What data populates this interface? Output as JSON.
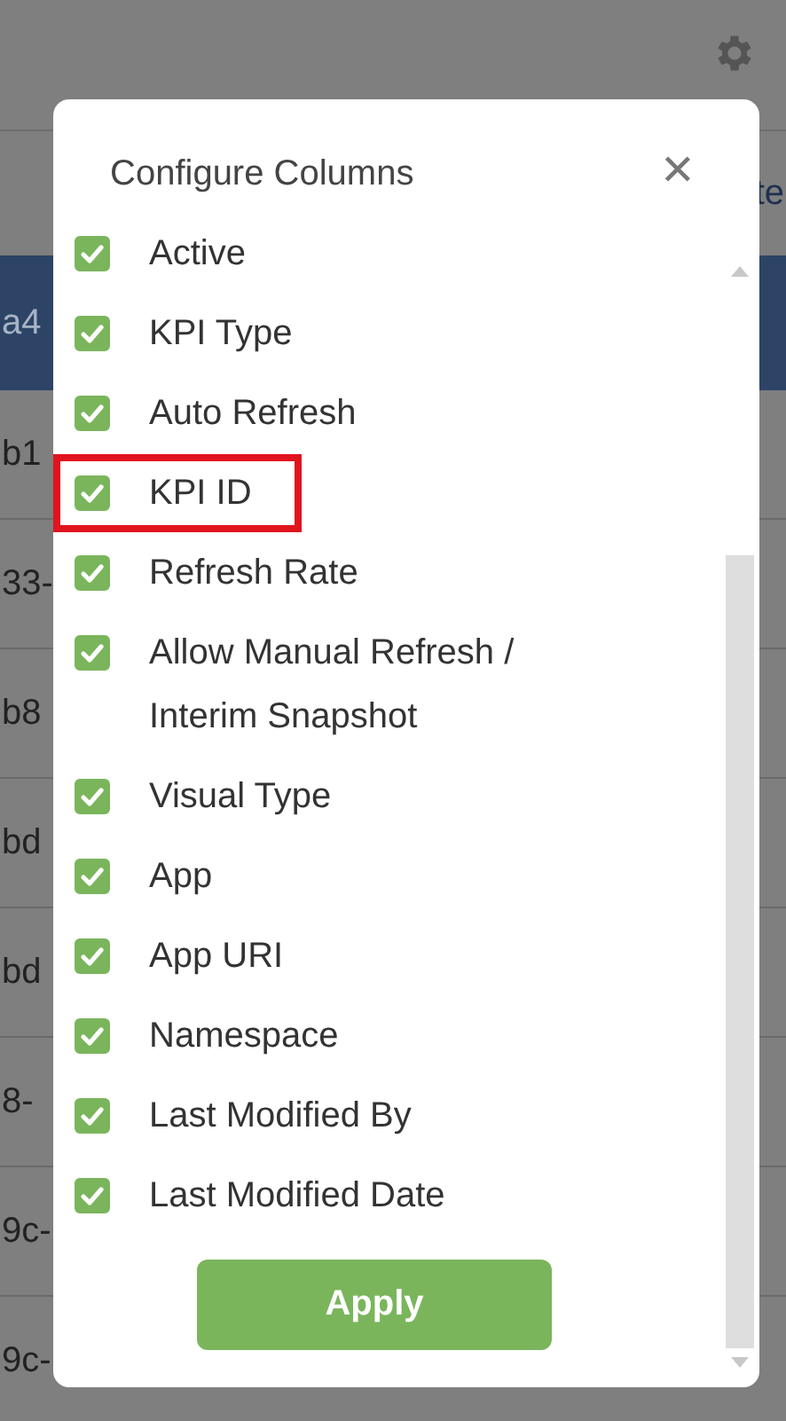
{
  "background_table": {
    "header_cell": "a4",
    "right_cell": "te",
    "rows": [
      "b1",
      "33-",
      "b8",
      "bd",
      "bd",
      "8-",
      "9c-",
      "9c-"
    ]
  },
  "dialog": {
    "title": "Configure Columns",
    "close": "✕",
    "columns": [
      {
        "label": "Active",
        "checked": true,
        "highlighted": false
      },
      {
        "label": "KPI Type",
        "checked": true,
        "highlighted": false
      },
      {
        "label": "Auto Refresh",
        "checked": true,
        "highlighted": false
      },
      {
        "label": "KPI ID",
        "checked": true,
        "highlighted": true
      },
      {
        "label": "Refresh Rate",
        "checked": true,
        "highlighted": false
      },
      {
        "label": "Allow Manual Refresh / Interim Snapshot",
        "checked": true,
        "highlighted": false
      },
      {
        "label": "Visual Type",
        "checked": true,
        "highlighted": false
      },
      {
        "label": "App",
        "checked": true,
        "highlighted": false
      },
      {
        "label": "App URI",
        "checked": true,
        "highlighted": false
      },
      {
        "label": "Namespace",
        "checked": true,
        "highlighted": false
      },
      {
        "label": "Last Modified By",
        "checked": true,
        "highlighted": false
      },
      {
        "label": "Last Modified Date",
        "checked": true,
        "highlighted": false
      }
    ],
    "apply_button": "Apply"
  }
}
